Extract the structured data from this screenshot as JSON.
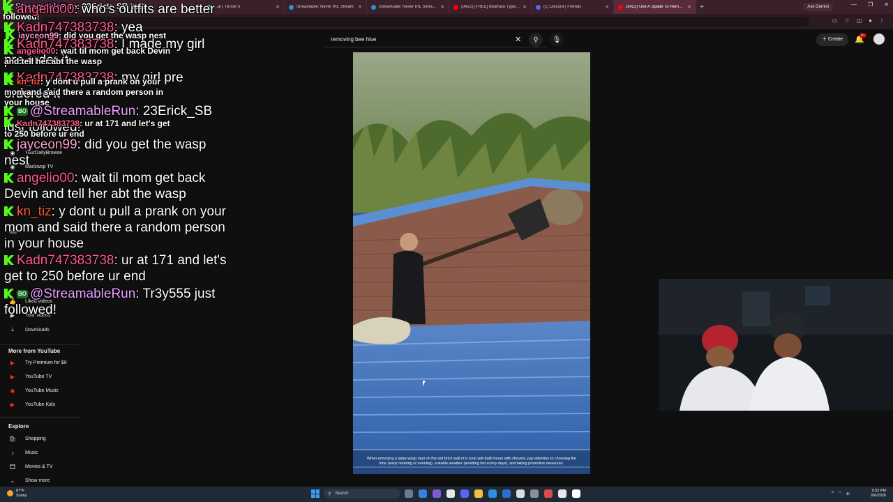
{
  "browser": {
    "tabs": [
      {
        "label": "...al | TikTok S",
        "fav": "#25f4ee"
      },
      {
        "label": "Streamable: Never IRL Stream",
        "fav": "#2e8fd6"
      },
      {
        "label": "Streamable: Never IRL Stream V",
        "fav": "#2e8fd6"
      },
      {
        "label": "(3422) [FREE] Blueface Type Be",
        "fav": "#ff0000"
      },
      {
        "label": "(1) Discord | Friends",
        "fav": "#5865f2"
      },
      {
        "label": "(3422) Use A Spade To Remove",
        "fav": "#ff0000"
      }
    ],
    "ask_gemini": "Ask Gemini"
  },
  "youtube": {
    "search_value": "removing bee hive",
    "create_label": "Create",
    "notification_badge": "9+"
  },
  "sidebar": {
    "you_label": "You",
    "items_top": [
      {
        "label": "YourDailyBrowse",
        "icon": "avatar-icon"
      },
      {
        "label": "Mackwop TV",
        "icon": "avatar-icon"
      },
      {
        "label": "Liked videos",
        "icon": "thumbs-up-icon"
      },
      {
        "label": "Your videos",
        "icon": "play-icon"
      },
      {
        "label": "Downloads",
        "icon": "download-icon"
      }
    ],
    "more_heading": "More from YouTube",
    "more_items": [
      {
        "label": "Try Premium for $0",
        "icon": "youtube-premium-icon"
      },
      {
        "label": "YouTube TV",
        "icon": "youtube-tv-icon"
      },
      {
        "label": "YouTube Music",
        "icon": "youtube-music-icon"
      },
      {
        "label": "YouTube Kids",
        "icon": "youtube-kids-icon"
      }
    ],
    "explore_heading": "Explore",
    "explore_items": [
      {
        "label": "Shopping",
        "icon": "bag-icon"
      },
      {
        "label": "Music",
        "icon": "music-note-icon"
      },
      {
        "label": "Movies & TV",
        "icon": "film-icon"
      },
      {
        "label": "Show more",
        "icon": "chevron-down-icon"
      }
    ]
  },
  "chat": [
    {
      "user": "StreamableRun",
      "color": "#e8a0ff",
      "msg": ": 23Erick_SB just",
      "cont": "followed!",
      "small": true
    },
    {
      "user": "angelio00",
      "color": "#ff5a8a",
      "msg": ": who's outfits are better"
    },
    {
      "user": "Kadn747383738",
      "color": "#ff5a8a",
      "msg": ": yea"
    },
    {
      "user": "jayceon99",
      "color": "#ff9fd4",
      "msg": ": did you get the wasp nest",
      "small": true
    },
    {
      "user": "Kadn747383738",
      "color": "#ff5a8a",
      "msg": ": I made my girl",
      "cont": "pre order it"
    },
    {
      "user": "angelio00",
      "color": "#ff5a8a",
      "msg": ": wait til mom get back Devin",
      "cont": "and tell her abt the wasp",
      "small": true
    },
    {
      "user": "Kadn747383738",
      "color": "#ff5a8a",
      "msg": ": my girl pre",
      "cont": "ordered it"
    },
    {
      "user": "kn_tiz",
      "color": "#ff5a3c",
      "msg": ": y dont u pull a prank on your",
      "cont": "mom and said there a random person in",
      "cont2": "your house",
      "small": true
    },
    {
      "user": "@StreamableRun",
      "color": "#e8a0ff",
      "msg": ": 23Erick_SB",
      "cont": "just followed!"
    },
    {
      "user": "Kadn747383738",
      "color": "#ff5a8a",
      "msg": ": ur at 171 and let's get",
      "cont": "to 250 before ur end",
      "small": true
    },
    {
      "user": "jayceon99",
      "color": "#ff9fd4",
      "msg": ": did you get the wasp",
      "cont": "nest"
    },
    {
      "user": "angelio00",
      "color": "#ff5a8a",
      "msg": ": wait til mom get back",
      "cont": "Devin and tell her abt the wasp"
    },
    {
      "user": "kn_tiz",
      "color": "#ff5a3c",
      "msg": ": y dont u pull a prank on your",
      "cont": "mom and said there a random person",
      "cont2": "in your house"
    },
    {
      "user": "Kadn747383738",
      "color": "#ff5a8a",
      "msg": ": ur at 171 and let's",
      "cont": "get to 250 before ur end"
    },
    {
      "user": "@StreamableRun",
      "color": "#e8a0ff",
      "msg": ": Tr3y555 just",
      "cont": "followed!"
    }
  ],
  "video": {
    "caption": "When removing a large wasp nest on the red brick wall of a rural self-built house with shovels, pay attention to choosing the time (early morning or evening), suitable weather (avoiding hot sunny days), and taking protective measures."
  },
  "webcam": {
    "hat_text": "ANTI SOCIAL CLUB"
  },
  "taskbar": {
    "weather_temp": "87°F",
    "weather_desc": "Sunny",
    "search_label": "Search",
    "time": "9:32 PM",
    "date": "8/6/2026"
  }
}
